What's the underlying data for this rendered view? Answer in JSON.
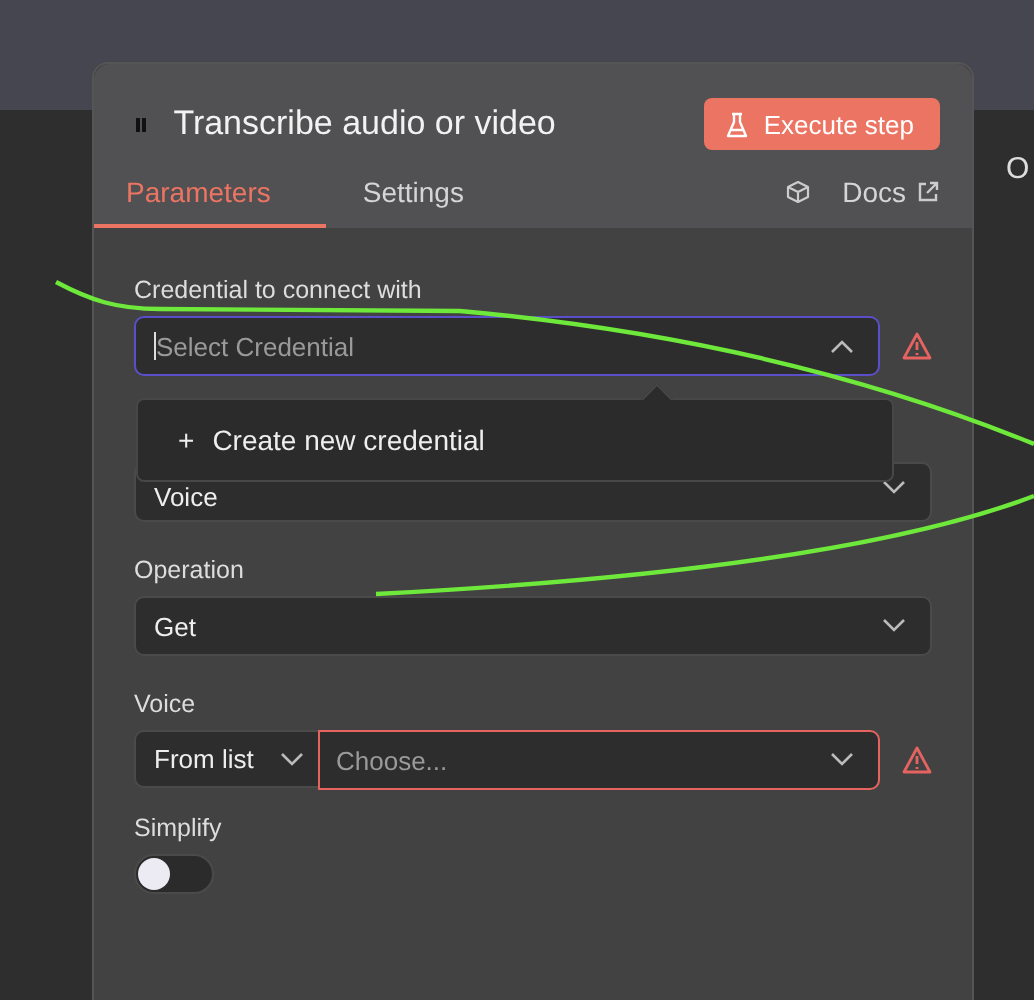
{
  "window": {
    "title": "Transcribe audio or video"
  },
  "execute_button": {
    "label": "Execute step"
  },
  "tabs": [
    {
      "label": "Parameters",
      "selected": true
    },
    {
      "label": "Settings",
      "selected": false
    }
  ],
  "docs_link": {
    "label": "Docs"
  },
  "side_text": "O",
  "fields": [
    {
      "kind": "select",
      "label": "Credential to connect with",
      "placeholder": "Select Credential",
      "focused": true,
      "open": true,
      "warning": true,
      "options": [
        {
          "symbol": "+",
          "label": "Create new credential"
        }
      ]
    },
    {
      "kind": "select",
      "value": "Voice",
      "focused": false,
      "open": false,
      "warning": false
    },
    {
      "kind": "select",
      "label": "Operation",
      "value": "Get",
      "focused": false,
      "open": false,
      "warning": false
    },
    {
      "kind": "resource",
      "label": "Voice",
      "mode": "From list",
      "placeholder": "Choose...",
      "warning": true
    },
    {
      "kind": "toggle",
      "label": "Simplify",
      "on": false
    }
  ]
}
